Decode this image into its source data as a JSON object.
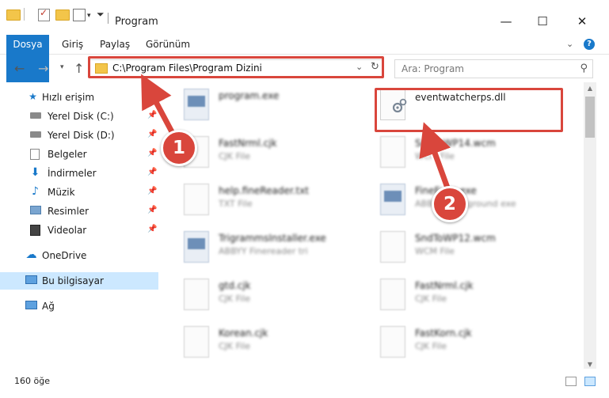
{
  "window": {
    "title": "Program"
  },
  "ribbon": {
    "tabs": [
      "Dosya",
      "Giriş",
      "Paylaş",
      "Görünüm"
    ]
  },
  "address": {
    "path": "C:\\Program Files\\Program Dizini"
  },
  "search": {
    "placeholder": "Ara: Program"
  },
  "sidebar": {
    "items": [
      {
        "label": "Hızlı erişim",
        "icon": "star-icon"
      },
      {
        "label": "Yerel Disk (C:)",
        "icon": "drive-icon",
        "pinned": true
      },
      {
        "label": "Yerel Disk (D:)",
        "icon": "drive-icon",
        "pinned": true
      },
      {
        "label": "Belgeler",
        "icon": "documents-icon",
        "pinned": true
      },
      {
        "label": "İndirmeler",
        "icon": "download-icon",
        "pinned": true
      },
      {
        "label": "Müzik",
        "icon": "music-icon",
        "pinned": true
      },
      {
        "label": "Resimler",
        "icon": "pictures-icon",
        "pinned": true
      },
      {
        "label": "Videolar",
        "icon": "video-icon",
        "pinned": true
      },
      {
        "label": "OneDrive",
        "icon": "cloud-icon"
      },
      {
        "label": "Bu bilgisayar",
        "icon": "computer-icon",
        "selected": true
      },
      {
        "label": "Ağ",
        "icon": "network-icon"
      }
    ]
  },
  "files": [
    {
      "name": "program.exe",
      "type": ""
    },
    {
      "name": "eventwatcherps.dll",
      "type": ""
    },
    {
      "name": "FastNrml.cjk",
      "type": "CJK File"
    },
    {
      "name": "SndToWP14.wcm",
      "type": "WCM File"
    },
    {
      "name": "help.fineReader.txt",
      "type": "TXT File"
    },
    {
      "name": "FineExec.exe",
      "type": "ABBYY Background exe"
    },
    {
      "name": "TrigrammsInstaller.exe",
      "type": "ABBYY Finereader tri"
    },
    {
      "name": "SndToWP12.wcm",
      "type": "WCM File"
    },
    {
      "name": "gtd.cjk",
      "type": "CJK File"
    },
    {
      "name": "FastNrml.cjk",
      "type": "CJK File"
    },
    {
      "name": "Korean.cjk",
      "type": "CJK File"
    },
    {
      "name": "FastKorn.cjk",
      "type": "CJK File"
    }
  ],
  "status": {
    "count": "160 öğe"
  },
  "annotations": {
    "step1": "1",
    "step2": "2",
    "color": "#d9463c"
  },
  "colors": {
    "accent": "#1979ca",
    "selected": "#cce8ff"
  }
}
